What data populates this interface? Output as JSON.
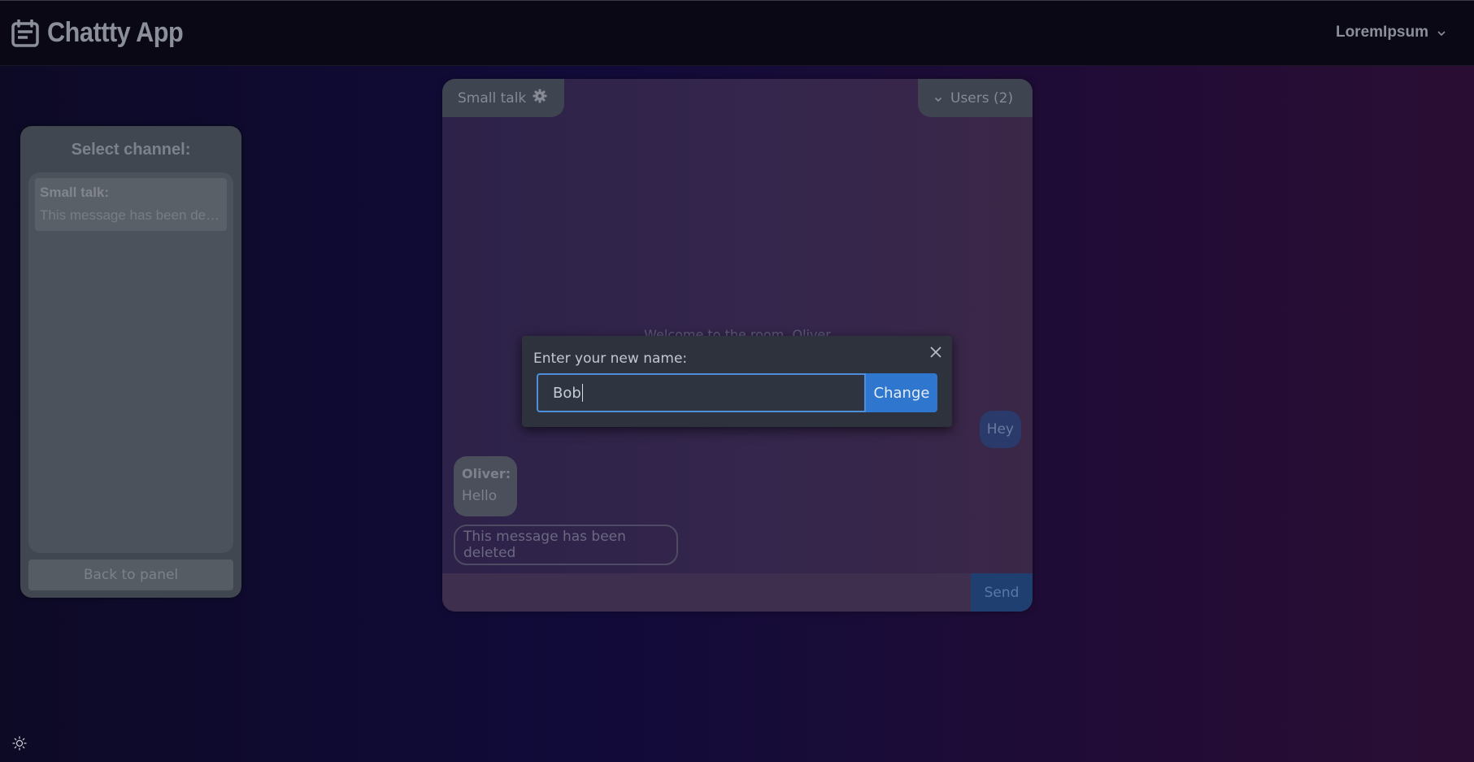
{
  "header": {
    "brand": "Chattty App",
    "user_name": "LoremIpsum"
  },
  "icons": {
    "brand": "calendar-note-icon",
    "user_menu": "chevron-down-icon",
    "room_settings": "gear-icon",
    "users_toggle": "chevron-down-icon",
    "modal_close": "close-icon",
    "theme": "sun-icon"
  },
  "sidebar": {
    "title": "Select channel:",
    "channels": [
      {
        "name": "Small talk:",
        "preview": "This message has been deleted"
      }
    ],
    "back_label": "Back to panel"
  },
  "chat": {
    "room_name": "Small talk",
    "users_label": "Users (2)",
    "welcome": "Welcome to the room, Oliver",
    "messages": [
      {
        "mine": true,
        "text": "Hey"
      },
      {
        "mine": false,
        "author": "Oliver:",
        "text": "Hello"
      },
      {
        "mine": false,
        "deleted": true,
        "text": "This message has been deleted"
      }
    ],
    "send_label": "Send"
  },
  "modal": {
    "label": "Enter your new name:",
    "input_value": "Bob",
    "submit_label": "Change"
  },
  "colors": {
    "accent": "#2f76cf",
    "focus_border": "#4e8fd9",
    "header_bg": "#0b0816"
  }
}
